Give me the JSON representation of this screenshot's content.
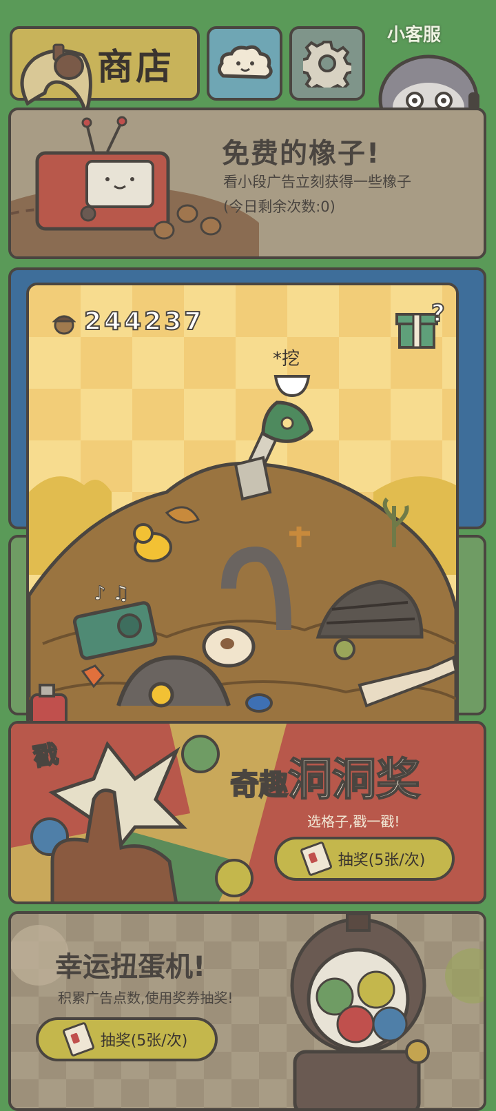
{
  "header": {
    "shop_label": "商店",
    "support_label": "小客服"
  },
  "free_acorns": {
    "title": "免费的橡子!",
    "subtitle": "看小段广告立刻获得一些橡子",
    "remaining": "(今日剩余次数:0)"
  },
  "dig": {
    "acorn_count": "244237",
    "dig_hint": "*挖"
  },
  "lottery": {
    "poke_label": "戳",
    "title_small": "奇趣",
    "title_big": "洞洞奖",
    "subtitle": "选格子,戳一戳!",
    "button_label": "抽奖(5张/次)"
  },
  "gacha": {
    "title": "幸运扭蛋机!",
    "subtitle": "积累广告点数,使用奖券抽奖!",
    "button_label": "抽奖(5张/次)"
  },
  "colors": {
    "background": "#5a9a58",
    "outline": "#4a4540",
    "button_yellow": "#c4b74c",
    "panel_tan": "#a89c85",
    "lottery_red": "#b8584b"
  }
}
